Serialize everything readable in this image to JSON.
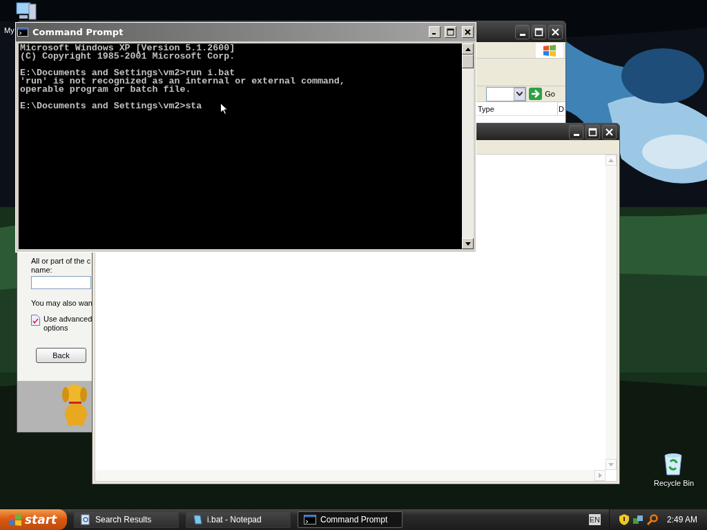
{
  "desktop": {
    "icons": [
      {
        "kind": "computer",
        "label": "My"
      },
      {
        "kind": "bin",
        "label": "Recycle Bin"
      }
    ]
  },
  "search_window": {
    "go_button": "Go",
    "columns": [
      "Type",
      "D"
    ],
    "panel": {
      "label_lines": [
        "All or part of the c",
        "name:"
      ],
      "hint": "You may also wan",
      "option_lines": [
        "Use advanced",
        "options"
      ],
      "back_button": "Back"
    }
  },
  "command_prompt": {
    "title": "Command Prompt",
    "blocks": [
      [
        "Microsoft Windows XP [Version 5.1.2600]",
        "(C) Copyright 1985-2001 Microsoft Corp."
      ],
      [
        "E:\\Documents and Settings\\vm2>run i.bat",
        "'run' is not recognized as an internal or external command,",
        "operable program or batch file."
      ],
      [
        "E:\\Documents and Settings\\vm2>sta"
      ]
    ]
  },
  "taskbar": {
    "start": "start",
    "tasks": [
      {
        "kind": "search",
        "label": "Search Results",
        "selected": false
      },
      {
        "kind": "notepad",
        "label": "i.bat - Notepad",
        "selected": false
      },
      {
        "kind": "console",
        "label": "Command Prompt",
        "selected": true
      }
    ],
    "language": "EN",
    "clock": "2:49 AM"
  }
}
